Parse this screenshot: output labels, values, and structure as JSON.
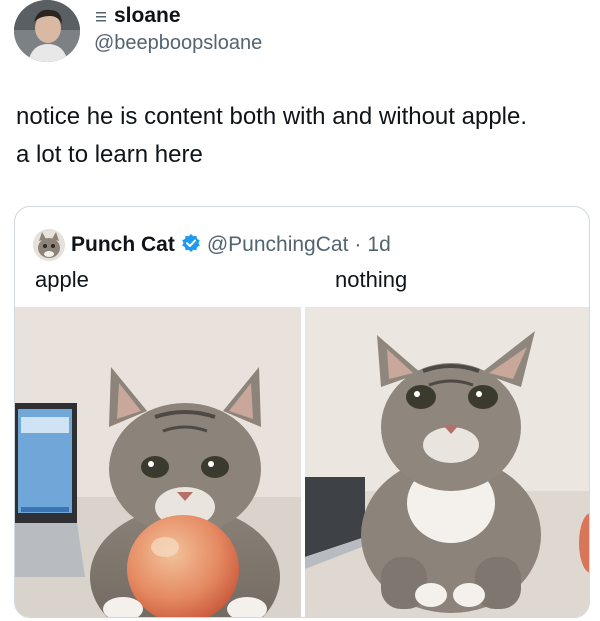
{
  "author": {
    "display_name": "sloane",
    "handle": "@beepboopsloane"
  },
  "tweet": {
    "lines": [
      "notice he is content both with and without apple.",
      "a lot to learn here"
    ]
  },
  "quoted": {
    "display_name": "Punch Cat",
    "handle": "@PunchingCat",
    "separator": "·",
    "age": "1d",
    "left_label": "apple",
    "right_label": "nothing"
  },
  "colors": {
    "verified": "#1d9bf0",
    "text_primary": "#0f1419",
    "text_secondary": "#536471",
    "border": "#cfd9de"
  },
  "icons": {
    "badge": "decorative-label-icon",
    "verified": "verified-badge-icon"
  }
}
